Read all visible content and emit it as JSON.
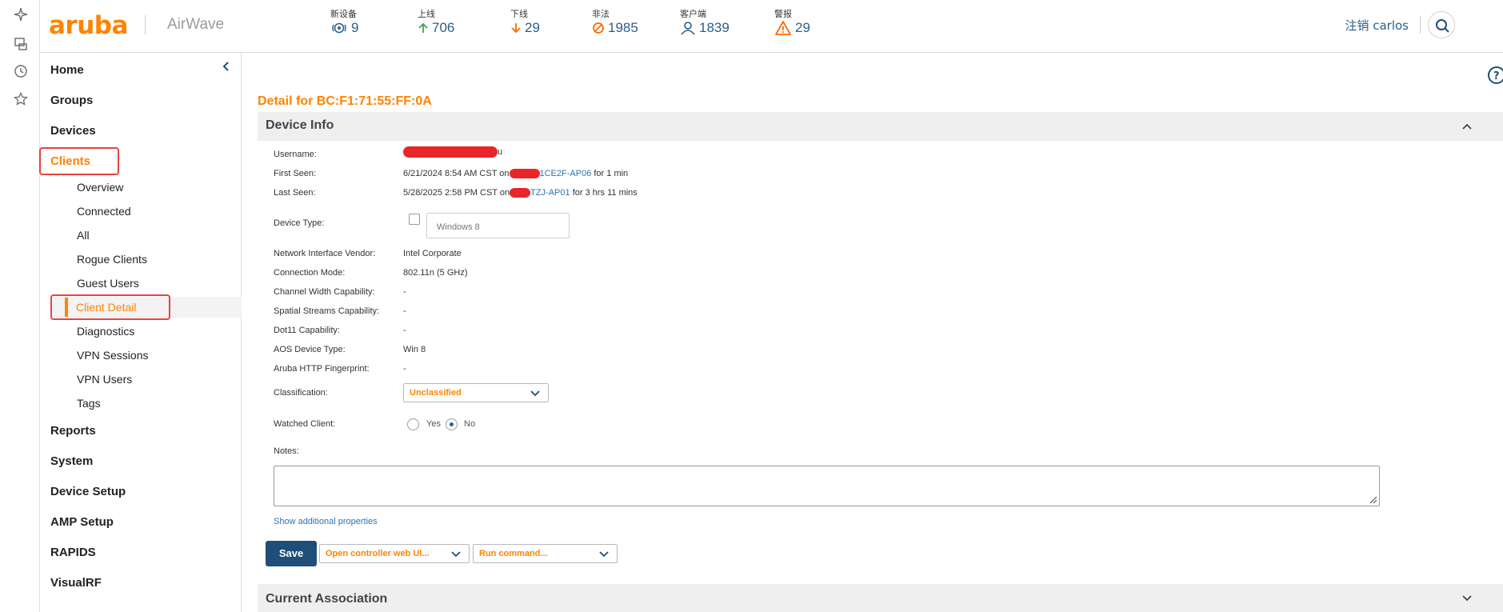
{
  "rail": {
    "icons": [
      "sparkle-icon",
      "device-icon",
      "clock-icon",
      "star-icon"
    ]
  },
  "header": {
    "logo": "aruba",
    "product": "AirWave",
    "stats": [
      {
        "label": "新设备",
        "value": "9",
        "icon": "new-device-icon",
        "color": "#2b5f8a"
      },
      {
        "label": "上线",
        "value": "706",
        "icon": "arrow-up-icon",
        "color": "#3aa65a"
      },
      {
        "label": "下线",
        "value": "29",
        "icon": "arrow-down-icon",
        "color": "#ff6a00"
      },
      {
        "label": "非法",
        "value": "1985",
        "icon": "prohibited-icon",
        "color": "#ff6a00"
      },
      {
        "label": "客户端",
        "value": "1839",
        "icon": "user-icon",
        "color": "#2b5f8a"
      },
      {
        "label": "警报",
        "value": "29",
        "icon": "warning-icon",
        "color": "#ff6a00"
      }
    ],
    "logout_label": "注销 carlos"
  },
  "nav": {
    "items": [
      {
        "label": "Home"
      },
      {
        "label": "Groups"
      },
      {
        "label": "Devices"
      },
      {
        "label": "Clients",
        "active": true
      },
      {
        "label": "Reports"
      },
      {
        "label": "System"
      },
      {
        "label": "Device Setup"
      },
      {
        "label": "AMP Setup"
      },
      {
        "label": "RAPIDS"
      },
      {
        "label": "VisualRF"
      }
    ],
    "client_sub_items": [
      {
        "label": "Overview"
      },
      {
        "label": "Connected"
      },
      {
        "label": "All"
      },
      {
        "label": "Rogue Clients"
      },
      {
        "label": "Guest Users"
      },
      {
        "label": "Client Detail",
        "active": true
      },
      {
        "label": "Diagnostics"
      },
      {
        "label": "VPN Sessions"
      },
      {
        "label": "VPN Users"
      },
      {
        "label": "Tags"
      }
    ]
  },
  "main": {
    "detail_title": "Detail for BC:F1:71:55:FF:0A",
    "device_info": {
      "title": "Device Info",
      "username_label": "Username:",
      "username_tail": "u",
      "first_seen_label": "First Seen:",
      "first_seen_date": "6/21/2024 8:54 AM CST on",
      "first_seen_ap": "1CE2F-AP06",
      "first_seen_duration": "for 1 min",
      "last_seen_label": "Last Seen:",
      "last_seen_date": "5/28/2025 2:58 PM CST on",
      "last_seen_ap": "TZJ-AP01",
      "last_seen_duration": "for 3 hrs 11 mins",
      "device_type_label": "Device Type:",
      "device_type_value": "Windows 8",
      "fields": [
        {
          "label": "Network Interface Vendor:",
          "value": "Intel Corporate"
        },
        {
          "label": "Connection Mode:",
          "value": "802.11n (5 GHz)"
        },
        {
          "label": "Channel Width Capability:",
          "value": "-"
        },
        {
          "label": "Spatial Streams Capability:",
          "value": "-"
        },
        {
          "label": "Dot11 Capability:",
          "value": "-"
        },
        {
          "label": "AOS Device Type:",
          "value": "Win 8"
        },
        {
          "label": "Aruba HTTP Fingerprint:",
          "value": "-"
        }
      ],
      "classification_label": "Classification:",
      "classification_value": "Unclassified",
      "watched_label": "Watched Client:",
      "watched_yes": "Yes",
      "watched_no": "No",
      "watched_selected": "No",
      "notes_label": "Notes:",
      "notes_value": "",
      "show_more": "Show additional properties"
    },
    "actions": {
      "save_label": "Save",
      "controller_label": "Open controller web UI...",
      "command_label": "Run command..."
    },
    "current_association": {
      "title": "Current Association"
    }
  }
}
